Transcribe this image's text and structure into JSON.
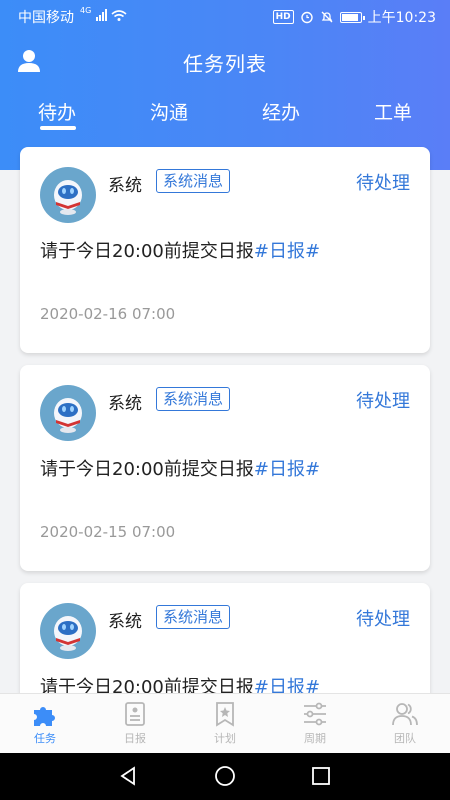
{
  "status_bar": {
    "carrier": "中国移动",
    "signal_label": "4G",
    "time": "上午10:23",
    "hd_label": "HD"
  },
  "header": {
    "title": "任务列表",
    "tabs": [
      {
        "label": "待办",
        "active": true
      },
      {
        "label": "沟通",
        "active": false
      },
      {
        "label": "经办",
        "active": false
      },
      {
        "label": "工单",
        "active": false
      }
    ]
  },
  "tasks": [
    {
      "sender": "系统",
      "tag": "系统消息",
      "status": "待处理",
      "content": "请于今日20:00前提交日报",
      "hashtag": "#日报#",
      "time": "2020-02-16 07:00"
    },
    {
      "sender": "系统",
      "tag": "系统消息",
      "status": "待处理",
      "content": "请于今日20:00前提交日报",
      "hashtag": "#日报#",
      "time": "2020-02-15 07:00"
    },
    {
      "sender": "系统",
      "tag": "系统消息",
      "status": "待处理",
      "content": "请于今日20:00前提交日报",
      "hashtag": "#日报#",
      "time": ""
    }
  ],
  "bottom_nav": [
    {
      "label": "任务",
      "icon": "puzzle-icon",
      "active": true
    },
    {
      "label": "日报",
      "icon": "report-icon",
      "active": false
    },
    {
      "label": "计划",
      "icon": "bookmark-star-icon",
      "active": false
    },
    {
      "label": "周期",
      "icon": "sliders-icon",
      "active": false
    },
    {
      "label": "团队",
      "icon": "team-icon",
      "active": false
    }
  ],
  "colors": {
    "header_blue": "#4b86f6",
    "accent_blue": "#3478d9",
    "active_nav": "#3c8df8",
    "inactive_nav": "#b7b7b7"
  }
}
